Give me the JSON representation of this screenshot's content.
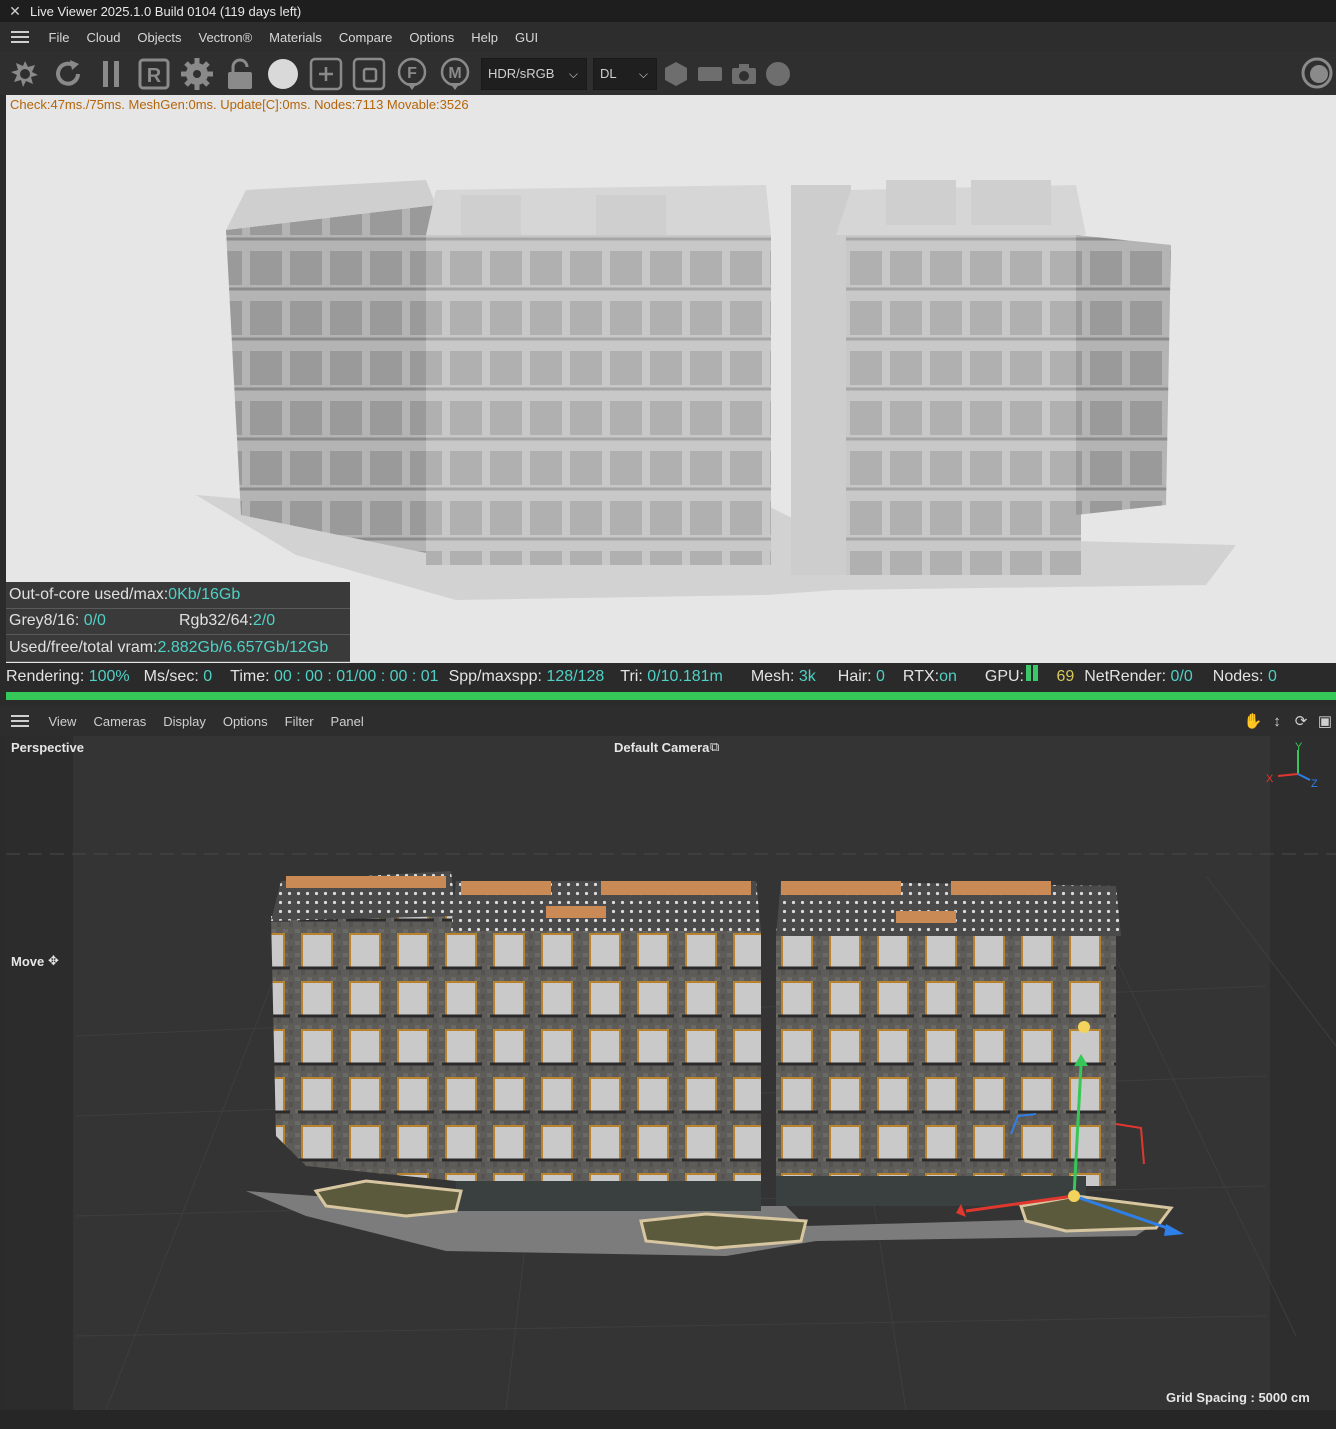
{
  "titlebar": {
    "close_glyph": "✕",
    "title": "Live Viewer 2025.1.0 Build 0104 (119 days left)"
  },
  "menu": [
    "File",
    "Cloud",
    "Objects",
    "Vectron®",
    "Materials",
    "Compare",
    "Options",
    "Help",
    "GUI"
  ],
  "toolbar": {
    "icons": [
      "settings-gear-arrows-icon",
      "refresh-icon",
      "pause-icon",
      "region-r-icon",
      "gear-icon",
      "lock-icon",
      "sphere-icon",
      "add-region-icon",
      "region-fit-icon",
      "focus-f-icon",
      "material-m-icon"
    ],
    "color_space": "HDR/sRGB",
    "kernel": "DL",
    "right_icons": [
      "cube-icon",
      "box-icon",
      "camera-icon",
      "circle-icon"
    ]
  },
  "render": {
    "check_line": "Check:47ms./75ms. MeshGen:0ms. Update[C]:0ms. Nodes:7113 Movable:3526",
    "memory": {
      "ooc_label": "Out-of-core used/max:",
      "ooc_value": "0Kb/16Gb",
      "grey_label": "Grey8/16: ",
      "grey_value": "0/0",
      "rgb_label": "Rgb32/64: ",
      "rgb_value": "2/0",
      "vram_label": "Used/free/total vram: ",
      "vram_value": "2.882Gb/6.657Gb/12Gb"
    }
  },
  "stats": {
    "rendering_label": "Rendering:",
    "rendering_value": "100%",
    "ms_label": "Ms/sec:",
    "ms_value": "0",
    "time_label": "Time:",
    "time_value": "00 : 00 : 01/00 : 00 : 01",
    "spp_label": "Spp/maxspp:",
    "spp_value": "128/128",
    "tri_label": "Tri:",
    "tri_value": "0/10.181m",
    "mesh_label": "Mesh:",
    "mesh_value": "3k",
    "hair_label": "Hair:",
    "hair_value": "0",
    "rtx_label": "RTX:",
    "rtx_value": "on",
    "gpu_label": "GPU:",
    "gpu_value": "69",
    "net_label": "NetRender:",
    "net_value": "0/0",
    "nodes_label": "Nodes:",
    "nodes_value": "0",
    "progress": 1.0
  },
  "viewport": {
    "menu": [
      "View",
      "Cameras",
      "Display",
      "Options",
      "Filter",
      "Panel"
    ],
    "projection": "Perspective",
    "camera": "Default Camera",
    "tool": "Move",
    "grid_spacing": "Grid Spacing : 5000 cm",
    "axes": {
      "x": "X",
      "y": "Y",
      "z": "Z"
    }
  },
  "colors": {
    "accent_cyan": "#4fd1c5",
    "progress_green": "#35c757",
    "check_orange": "#b4650a"
  }
}
